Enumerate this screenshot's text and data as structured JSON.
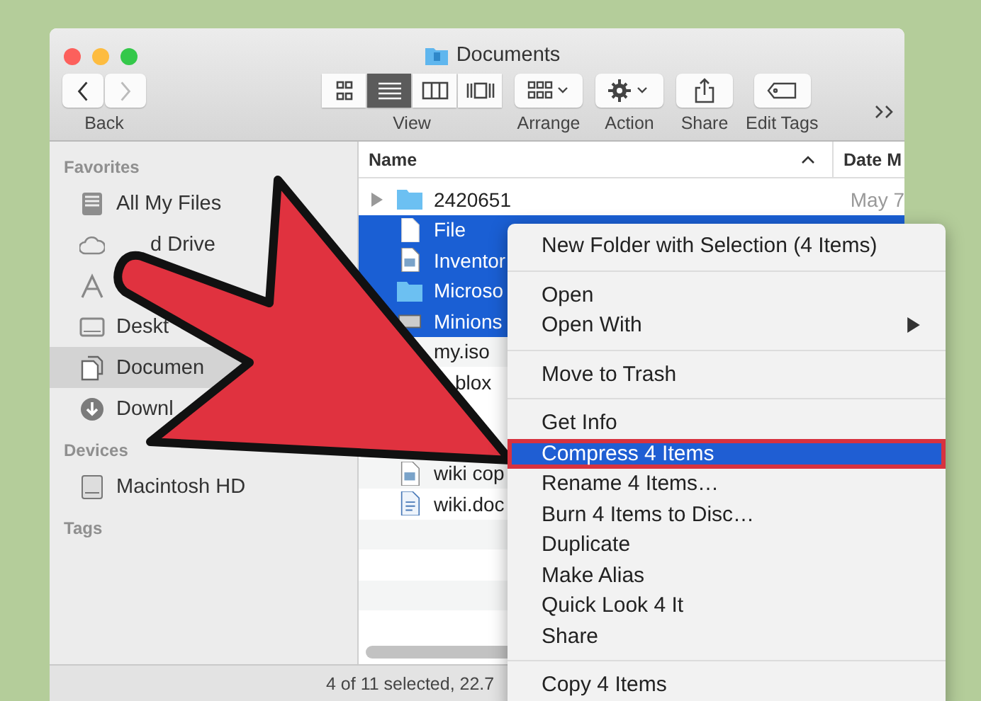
{
  "window": {
    "title": "Documents"
  },
  "toolbar": {
    "back_label": "Back",
    "view_modes": [
      {
        "selected": false
      },
      {
        "selected": true
      },
      {
        "selected": false
      },
      {
        "selected": false
      }
    ],
    "view_label": "View",
    "buttons": [
      {
        "label": "Arrange"
      },
      {
        "label": "Action"
      },
      {
        "label": "Share"
      },
      {
        "label": "Edit Tags"
      }
    ]
  },
  "sidebar": [
    {
      "heading": "Favorites",
      "items": [
        {
          "label": "All My Files",
          "selected": false
        },
        {
          "label": "d Drive",
          "selected": false
        },
        {
          "selected": false
        },
        {
          "label": "Deskt",
          "selected": false
        },
        {
          "label": "Documen",
          "selected": true
        },
        {
          "label": "Downl",
          "selected": false
        }
      ]
    },
    {
      "heading": "Devices",
      "items": [
        {
          "label": "Macintosh HD",
          "selected": false
        }
      ]
    },
    {
      "heading": "Tags"
    }
  ],
  "file_list": {
    "columns": [
      {
        "label": "Name",
        "sorted": true
      },
      {
        "label": "Date M",
        "sorted": false
      }
    ],
    "rows": [
      {
        "name": "2420651",
        "date": "May 7",
        "expandable": true,
        "selected": false
      },
      {
        "name": "File",
        "expandable": false,
        "selected": true
      },
      {
        "name": "Inventor",
        "expandable": false,
        "selected": true
      },
      {
        "name": "Microso",
        "expandable": false,
        "selected": true
      },
      {
        "name": "Minions",
        "expandable": false,
        "selected": true
      },
      {
        "name": "my.iso",
        "expandable": false,
        "selected": false
      },
      {
        "name": "blox",
        "expandable": false,
        "selected": false
      },
      {
        "name": "wiki cop",
        "expandable": false,
        "selected": false
      },
      {
        "name": "wiki.doc",
        "expandable": false,
        "selected": false
      }
    ]
  },
  "context_menu": [
    {
      "kind": "item",
      "label": "New Folder with Selection (4 Items)",
      "selected": false,
      "submenu": false
    },
    {
      "kind": "separator"
    },
    {
      "kind": "item",
      "label": "Open",
      "selected": false,
      "submenu": false
    },
    {
      "kind": "item",
      "label": "Open With",
      "selected": false,
      "submenu": true
    },
    {
      "kind": "separator"
    },
    {
      "kind": "item",
      "label": "Move to Trash",
      "selected": false,
      "submenu": false
    },
    {
      "kind": "separator"
    },
    {
      "kind": "item",
      "label": "Get Info",
      "selected": false,
      "submenu": false
    },
    {
      "kind": "item",
      "label": "Compress 4 Items",
      "selected": true,
      "submenu": false
    },
    {
      "kind": "item",
      "label": "Rename 4 Items…",
      "selected": false,
      "submenu": false
    },
    {
      "kind": "item",
      "label": "Burn 4 Items to Disc…",
      "selected": false,
      "submenu": false
    },
    {
      "kind": "item",
      "label": "Duplicate",
      "selected": false,
      "submenu": false
    },
    {
      "kind": "item",
      "label": "Make Alias",
      "selected": false,
      "submenu": false
    },
    {
      "kind": "item",
      "label": "Quick Look 4 It",
      "selected": false,
      "submenu": false
    },
    {
      "kind": "item",
      "label": "Share",
      "selected": false,
      "submenu": false
    },
    {
      "kind": "separator"
    },
    {
      "kind": "item",
      "label": "Copy 4 Items",
      "selected": false,
      "submenu": false
    }
  ],
  "status_bar": "4 of 11 selected, 22.7"
}
